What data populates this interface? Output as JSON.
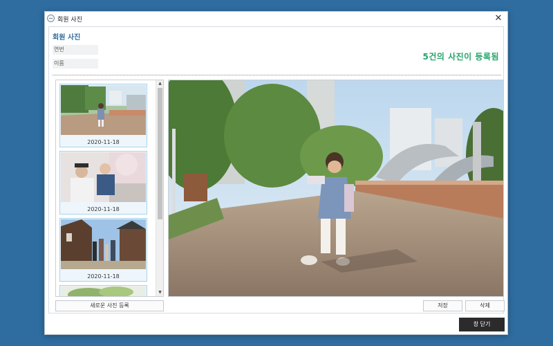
{
  "window": {
    "title": "회원 사진",
    "close_glyph": "✕"
  },
  "panel": {
    "title": "회원 사진",
    "fields": [
      {
        "label": "연번"
      },
      {
        "label": "이름"
      }
    ],
    "count_text": "5건의 사진이 등록됨"
  },
  "thumbnails": [
    {
      "date": "2020-11-18",
      "scene": "child-in-hanbok-park"
    },
    {
      "date": "2020-11-18",
      "scene": "father-and-child-selfie"
    },
    {
      "date": "2020-11-18",
      "scene": "family-by-wooden-house"
    },
    {
      "date": "",
      "scene": "plant-leaves"
    }
  ],
  "scroll": {
    "up_glyph": "▲",
    "down_glyph": "▼"
  },
  "buttons": {
    "add_photo": "새로운 사진 등록",
    "save": "저장",
    "delete": "삭제",
    "close_window": "창 닫기"
  },
  "icons": {
    "app": "app-logo-icon",
    "close": "close-icon",
    "scroll_up": "scroll-up-icon",
    "scroll_down": "scroll-down-icon"
  },
  "colors": {
    "accent": "#2f6c9f",
    "count_green": "#26a46a",
    "thumb_border": "#a9d2ea",
    "close_button_bg": "#2b2b2b"
  }
}
